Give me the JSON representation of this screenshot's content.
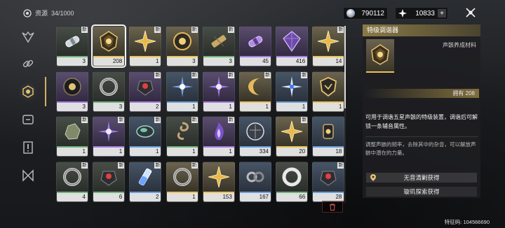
{
  "header": {
    "bag_label": "资源",
    "bag_count": "34/1000",
    "currency_1": {
      "icon": "shell-credit-icon",
      "value": "790112"
    },
    "currency_2": {
      "icon": "astrite-icon",
      "value": "10833",
      "add": "+"
    }
  },
  "sidebar": {
    "tabs": [
      "faction-icon",
      "chain-icon",
      "resource-icon",
      "supply-icon",
      "quest-item-icon",
      "echo-icon"
    ],
    "active": 2
  },
  "new_label": "新",
  "items": [
    {
      "name": "capsule",
      "count": "3",
      "rarity": 2,
      "new": true
    },
    {
      "name": "gold-tuner",
      "count": "208",
      "rarity": 5,
      "new": false,
      "selected": true
    },
    {
      "name": "gold-star",
      "count": "1",
      "rarity": 5,
      "new": true
    },
    {
      "name": "gold-sphere",
      "count": "3",
      "rarity": 5,
      "new": true
    },
    {
      "name": "brass-tube",
      "count": "3",
      "rarity": 2,
      "new": true
    },
    {
      "name": "purple-capsule",
      "count": "45",
      "rarity": 4,
      "new": false
    },
    {
      "name": "purple-gem",
      "count": "416",
      "rarity": 4,
      "new": false
    },
    {
      "name": "gold-star",
      "count": "14",
      "rarity": 5,
      "new": true
    },
    {
      "name": "dark-orb",
      "count": "3",
      "rarity": 4,
      "new": false
    },
    {
      "name": "ring",
      "count": "3",
      "rarity": 2,
      "new": false
    },
    {
      "name": "red-core",
      "count": "2",
      "rarity": 4,
      "new": true
    },
    {
      "name": "blue-burst",
      "count": "1",
      "rarity": 3,
      "new": true
    },
    {
      "name": "violet-burst",
      "count": "1",
      "rarity": 4,
      "new": true
    },
    {
      "name": "crescent",
      "count": "1",
      "rarity": 5,
      "new": true
    },
    {
      "name": "white-burst",
      "count": "1",
      "rarity": 3,
      "new": true
    },
    {
      "name": "gold-shield",
      "count": "1",
      "rarity": 5,
      "new": false
    },
    {
      "name": "moss-stone",
      "count": "1",
      "rarity": 2,
      "new": true
    },
    {
      "name": "violet-burst",
      "count": "1",
      "rarity": 4,
      "new": true
    },
    {
      "name": "opal",
      "count": "1",
      "rarity": 3,
      "new": true
    },
    {
      "name": "spiral",
      "count": "1",
      "rarity": 2,
      "new": true
    },
    {
      "name": "violet-flame",
      "count": "1",
      "rarity": 4,
      "new": true
    },
    {
      "name": "silver-orb",
      "count": "334",
      "rarity": 3,
      "new": false
    },
    {
      "name": "gold-star",
      "count": "20",
      "rarity": 5,
      "new": true
    },
    {
      "name": "dark-lantern",
      "count": "18",
      "rarity": 3,
      "new": false
    },
    {
      "name": "ring",
      "count": "4",
      "rarity": 2,
      "new": true
    },
    {
      "name": "red-core",
      "count": "6",
      "rarity": 2,
      "new": true
    },
    {
      "name": "vial",
      "count": "2",
      "rarity": 3,
      "new": true
    },
    {
      "name": "ring",
      "count": "1",
      "rarity": 5,
      "new": true
    },
    {
      "name": "gold-star",
      "count": "153",
      "rarity": 5,
      "new": false
    },
    {
      "name": "chain",
      "count": "167",
      "rarity": 3,
      "new": false
    },
    {
      "name": "silver-ring",
      "count": "66",
      "rarity": 2,
      "new": false
    },
    {
      "name": "red-core",
      "count": "28",
      "rarity": 3,
      "new": true
    }
  ],
  "detail": {
    "title": "特级调谐器",
    "type": "声骸养成材料",
    "owned": "拥有 208",
    "description": "可用于调谐五星声骸的特级装置，调谐后可解锁一条辅音属性。",
    "flavor": "调整声骸的频率，去除其中的杂音，可以解放声骸中潜在的力量。",
    "sources": [
      "无音清剿获得",
      "璇玑探索获得"
    ]
  },
  "footer": {
    "uid": "特征码: 104566690"
  },
  "colors": {
    "accent_gold": "#d4b160",
    "rarity5": "#e8c35a",
    "rarity4": "#a67ee0",
    "rarity3": "#6aa0d8",
    "rarity2": "#6fb27a"
  }
}
